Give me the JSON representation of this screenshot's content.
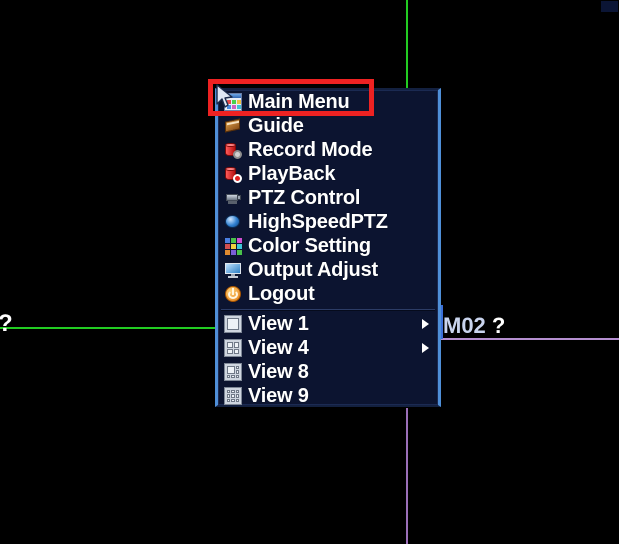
{
  "app": {
    "type": "dvr-osd-context-menu",
    "background_color": "#000000"
  },
  "wall": {
    "labels": [
      {
        "name": "left-channel-marker",
        "text": "?"
      },
      {
        "name": "channel-name",
        "text": "M02"
      },
      {
        "name": "channel-status-marker",
        "text": "?"
      }
    ],
    "guides": [
      {
        "name": "green-vertical-divider",
        "color": "#22cc22",
        "orientation": "vertical"
      },
      {
        "name": "green-horizontal-divider",
        "color": "#22cc22",
        "orientation": "horizontal"
      },
      {
        "name": "purple-vertical-divider",
        "color": "#9b6fb8",
        "orientation": "vertical"
      },
      {
        "name": "purple-horizontal-divider",
        "color": "#b58fd0",
        "orientation": "horizontal"
      },
      {
        "name": "blue-vertical-divider",
        "color": "#3a6fd8",
        "orientation": "vertical"
      }
    ]
  },
  "context_menu": {
    "background_color": "#0c1430",
    "border_color": "#4f8fd8",
    "text_color": "#ffffff",
    "highlight": {
      "target_item": "Main Menu",
      "color": "#ee2222",
      "style": "red-rectangle-annotation"
    },
    "groups": [
      {
        "name": "primary",
        "items": [
          {
            "label": "Main Menu",
            "icon": "main-menu-icon",
            "submenu": false,
            "highlighted": true
          },
          {
            "label": "Guide",
            "icon": "guide-book-icon",
            "submenu": false,
            "highlighted": false
          },
          {
            "label": "Record Mode",
            "icon": "record-mode-icon",
            "submenu": false,
            "highlighted": false
          },
          {
            "label": "PlayBack",
            "icon": "playback-icon",
            "submenu": false,
            "highlighted": false
          },
          {
            "label": "PTZ Control",
            "icon": "ptz-camera-icon",
            "submenu": false,
            "highlighted": false
          },
          {
            "label": "HighSpeedPTZ",
            "icon": "speed-dome-icon",
            "submenu": false,
            "highlighted": false
          },
          {
            "label": "Color Setting",
            "icon": "color-palette-icon",
            "submenu": false,
            "highlighted": false
          },
          {
            "label": "Output Adjust",
            "icon": "monitor-icon",
            "submenu": false,
            "highlighted": false
          },
          {
            "label": "Logout",
            "icon": "power-icon",
            "submenu": false,
            "highlighted": false
          }
        ]
      },
      {
        "name": "views",
        "items": [
          {
            "label": "View 1",
            "icon": "view-1-layout-icon",
            "submenu": true,
            "highlighted": false
          },
          {
            "label": "View 4",
            "icon": "view-4-layout-icon",
            "submenu": true,
            "highlighted": false
          },
          {
            "label": "View 8",
            "icon": "view-8-layout-icon",
            "submenu": false,
            "highlighted": false
          },
          {
            "label": "View 9",
            "icon": "view-9-layout-icon",
            "submenu": false,
            "highlighted": false
          }
        ]
      }
    ]
  },
  "pointer": {
    "name": "mouse-cursor",
    "position_label": "over Main Menu"
  }
}
